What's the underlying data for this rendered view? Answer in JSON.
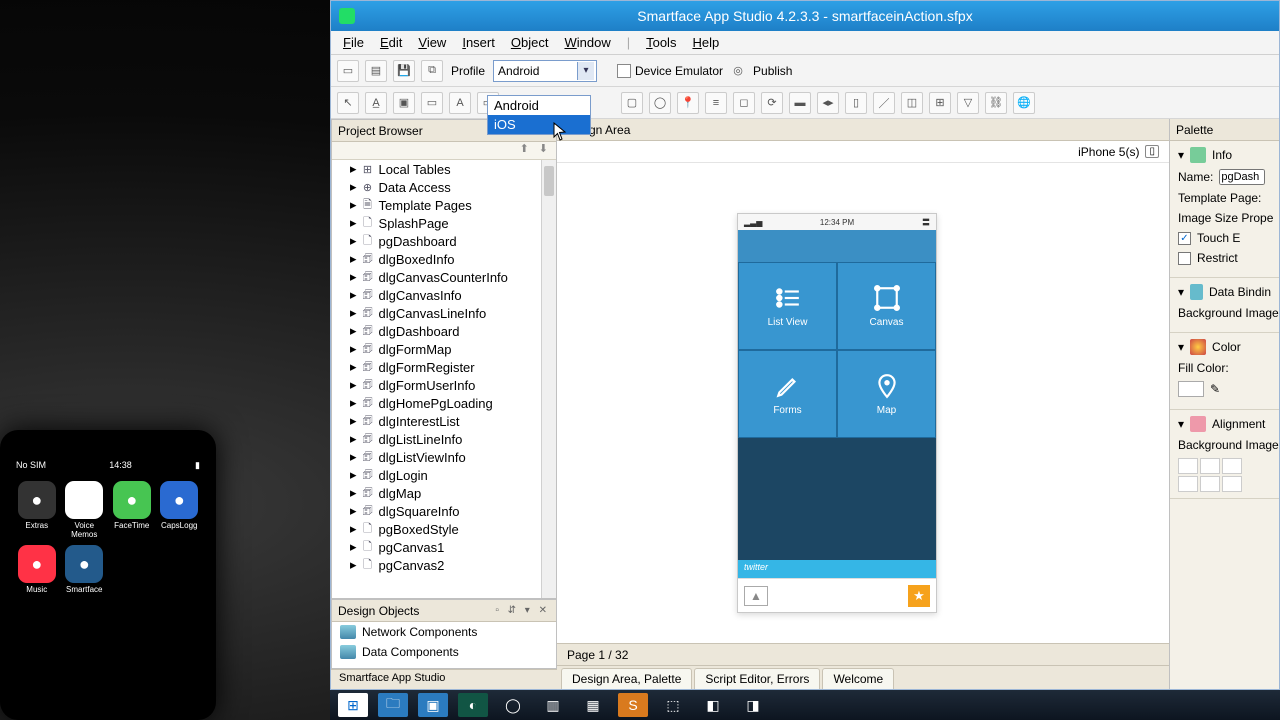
{
  "titlebar": "Smartface App Studio 4.2.3.3 - smartfaceinAction.sfpx",
  "menu": {
    "file": "File",
    "edit": "Edit",
    "view": "View",
    "insert": "Insert",
    "object": "Object",
    "window": "Window",
    "tools": "Tools",
    "help": "Help"
  },
  "toolbar1": {
    "profile_label": "Profile",
    "profile_value": "Android",
    "profile_options": [
      "Android",
      "iOS"
    ],
    "device_emulator": "Device Emulator",
    "publish": "Publish"
  },
  "panels": {
    "project_browser": "Project Browser",
    "design_area": "Design Area",
    "design_objects": "Design Objects",
    "palette": "Palette"
  },
  "tree": [
    {
      "icon": "⊞",
      "label": "Local Tables"
    },
    {
      "icon": "⊕",
      "label": "Data Access"
    },
    {
      "icon": "🗎",
      "label": "Template Pages"
    },
    {
      "icon": "🗋",
      "label": "SplashPage"
    },
    {
      "icon": "🗋",
      "label": "pgDashboard"
    },
    {
      "icon": "🗊",
      "label": "dlgBoxedInfo"
    },
    {
      "icon": "🗊",
      "label": "dlgCanvasCounterInfo"
    },
    {
      "icon": "🗊",
      "label": "dlgCanvasInfo"
    },
    {
      "icon": "🗊",
      "label": "dlgCanvasLineInfo"
    },
    {
      "icon": "🗊",
      "label": "dlgDashboard"
    },
    {
      "icon": "🗊",
      "label": "dlgFormMap"
    },
    {
      "icon": "🗊",
      "label": "dlgFormRegister"
    },
    {
      "icon": "🗊",
      "label": "dlgFormUserInfo"
    },
    {
      "icon": "🗊",
      "label": "dlgHomePgLoading"
    },
    {
      "icon": "🗊",
      "label": "dlgInterestList"
    },
    {
      "icon": "🗊",
      "label": "dlgListLineInfo"
    },
    {
      "icon": "🗊",
      "label": "dlgListViewInfo"
    },
    {
      "icon": "🗊",
      "label": "dlgLogin"
    },
    {
      "icon": "🗊",
      "label": "dlgMap"
    },
    {
      "icon": "🗊",
      "label": "dlgSquareInfo"
    },
    {
      "icon": "🗋",
      "label": "pgBoxedStyle"
    },
    {
      "icon": "🗋",
      "label": "pgCanvas1"
    },
    {
      "icon": "🗋",
      "label": "pgCanvas2"
    }
  ],
  "design_objects": {
    "network": "Network Components",
    "data": "Data Components"
  },
  "statusbar": "Smartface App Studio",
  "design": {
    "device": "iPhone 5(s)",
    "clock": "12:34 PM",
    "tiles": {
      "listview": "List View",
      "canvas": "Canvas",
      "forms": "Forms",
      "map": "Map"
    },
    "band": "twitter",
    "pager": "Page   1 / 32"
  },
  "tabs": {
    "design": "Design Area, Palette",
    "script": "Script Editor, Errors",
    "welcome": "Welcome"
  },
  "palette": {
    "info": "Info",
    "name_label": "Name:",
    "name_value": "pgDash",
    "template_page": "Template Page:",
    "image_size": "Image Size Prope",
    "touch": "Touch E",
    "restrict": "Restrict",
    "data_binding": "Data Bindin",
    "bg_image": "Background Image:",
    "color": "Color",
    "fill_color": "Fill Color:",
    "alignment": "Alignment",
    "bg_image2": "Background Image:"
  },
  "iphone": {
    "status_left": "No SIM",
    "status_time": "14:38",
    "apps": [
      {
        "label": "Extras",
        "bg": "#333"
      },
      {
        "label": "Voice Memos",
        "bg": "#fff"
      },
      {
        "label": "FaceTime",
        "bg": "#47c552"
      },
      {
        "label": "CapsLogg",
        "bg": "#2a6ad1"
      },
      {
        "label": "Music",
        "bg": "#ff3246"
      },
      {
        "label": "Smartface",
        "bg": "#235a8b"
      }
    ]
  }
}
